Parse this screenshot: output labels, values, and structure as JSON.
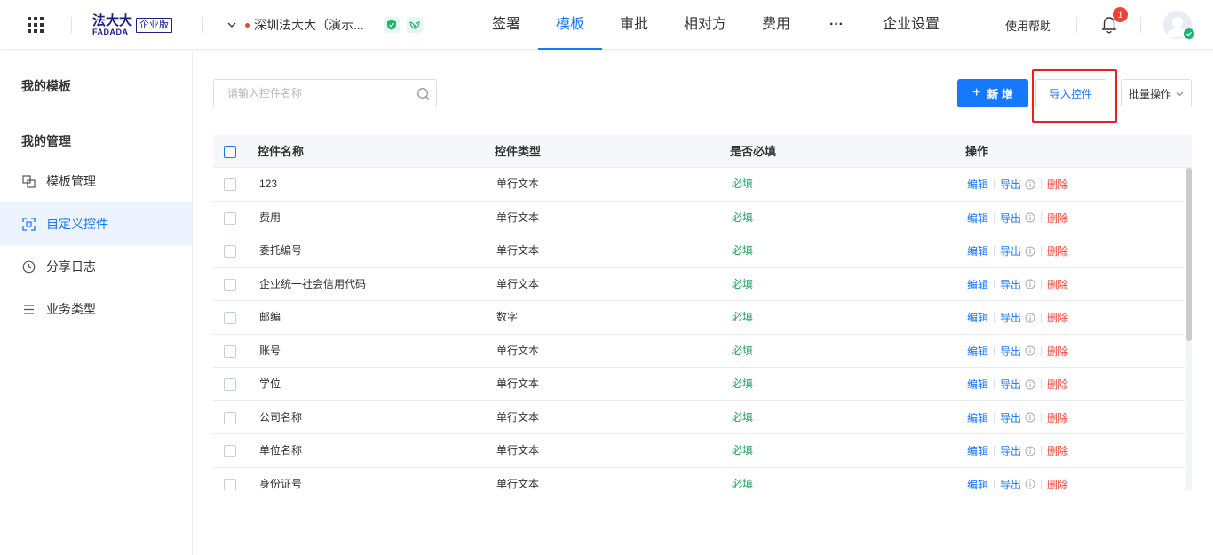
{
  "header": {
    "logo_cn": "法大大",
    "logo_en": "FADADA",
    "logo_badge": "企业版",
    "company_name": "深圳法大大（演示...",
    "nav": [
      {
        "label": "签署",
        "active": false
      },
      {
        "label": "模板",
        "active": true
      },
      {
        "label": "审批",
        "active": false
      },
      {
        "label": "相对方",
        "active": false
      },
      {
        "label": "费用",
        "active": false
      },
      {
        "label": "···",
        "active": false
      },
      {
        "label": "企业设置",
        "active": false
      }
    ],
    "help": "使用帮助",
    "notification_count": "1"
  },
  "sidebar": {
    "section1": "我的模板",
    "section2": "我的管理",
    "items": [
      {
        "label": "模板管理",
        "icon": "template-icon",
        "active": false
      },
      {
        "label": "自定义控件",
        "icon": "scan-icon",
        "active": true
      },
      {
        "label": "分享日志",
        "icon": "clock-icon",
        "active": false
      },
      {
        "label": "业务类型",
        "icon": "list-icon",
        "active": false
      }
    ]
  },
  "toolbar": {
    "search_placeholder": "请输入控件名称",
    "new_label": "新 增",
    "import_label": "导入控件",
    "batch_label": "批量操作"
  },
  "table": {
    "headers": [
      "控件名称",
      "控件类型",
      "是否必填",
      "操作"
    ],
    "ops": {
      "edit": "编辑",
      "export": "导出",
      "delete": "删除"
    },
    "rows": [
      {
        "name": "123",
        "type": "单行文本",
        "required": "必填"
      },
      {
        "name": "费用",
        "type": "单行文本",
        "required": "必填"
      },
      {
        "name": "委托编号",
        "type": "单行文本",
        "required": "必填"
      },
      {
        "name": "企业统一社会信用代码",
        "type": "单行文本",
        "required": "必填"
      },
      {
        "name": "邮编",
        "type": "数字",
        "required": "必填"
      },
      {
        "name": "账号",
        "type": "单行文本",
        "required": "必填"
      },
      {
        "name": "学位",
        "type": "单行文本",
        "required": "必填"
      },
      {
        "name": "公司名称",
        "type": "单行文本",
        "required": "必填"
      },
      {
        "name": "单位名称",
        "type": "单行文本",
        "required": "必填"
      },
      {
        "name": "身份证号",
        "type": "单行文本",
        "required": "必填"
      }
    ]
  },
  "colors": {
    "accent": "#1677ff",
    "required": "#19a25d",
    "danger": "#f04134",
    "highlight": "#ee1c1c"
  }
}
